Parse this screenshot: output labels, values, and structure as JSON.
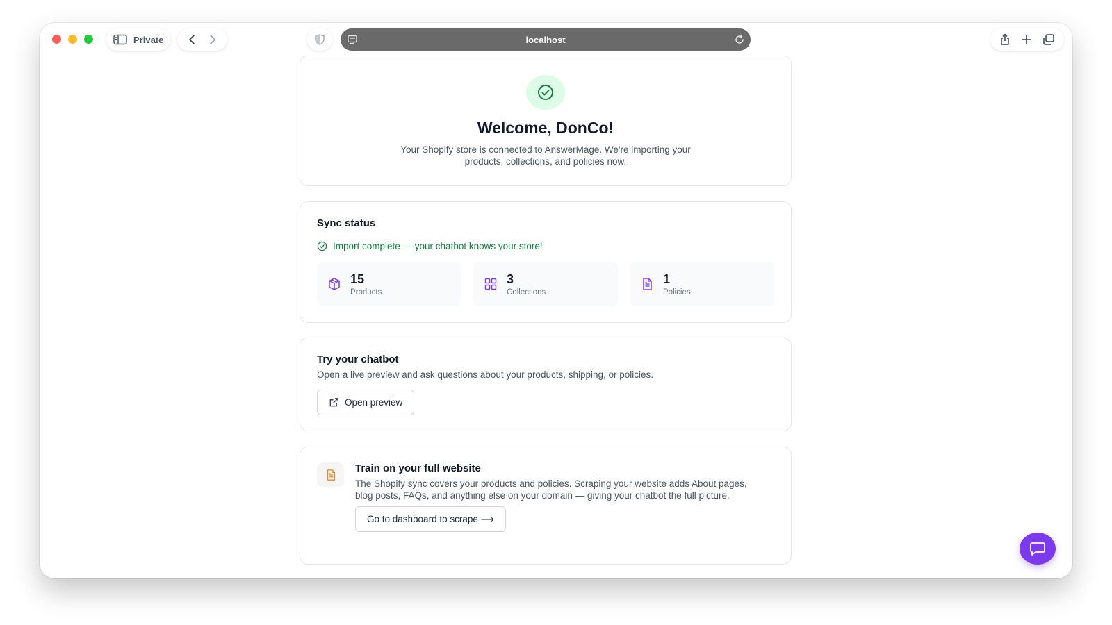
{
  "browser": {
    "private_label": "Private",
    "url": "localhost"
  },
  "welcome": {
    "title": "Welcome, DonCo!",
    "description": "Your Shopify store is connected to AnswerMage. We're importing your products, collections, and policies now."
  },
  "sync": {
    "title": "Sync status",
    "status_text": "Import complete — your chatbot knows your store!",
    "status_color": "#15803d",
    "stats": [
      {
        "value": "15",
        "label": "Products",
        "icon": "package-icon"
      },
      {
        "value": "3",
        "label": "Collections",
        "icon": "grid-icon"
      },
      {
        "value": "1",
        "label": "Policies",
        "icon": "document-icon"
      }
    ]
  },
  "chatbot": {
    "title": "Try your chatbot",
    "description": "Open a live preview and ask questions about your products, shipping, or policies.",
    "button_label": "Open preview"
  },
  "train": {
    "title": "Train on your full website",
    "description": "The Shopify sync covers your products and policies. Scraping your website adds About pages, blog posts, FAQs, and anything else on your domain — giving your chatbot the full picture.",
    "button_label": "Go to dashboard to scrape ⟶"
  },
  "colors": {
    "accent": "#7c3aed",
    "success": "#15803d",
    "train_icon": "#ea8a1c"
  }
}
